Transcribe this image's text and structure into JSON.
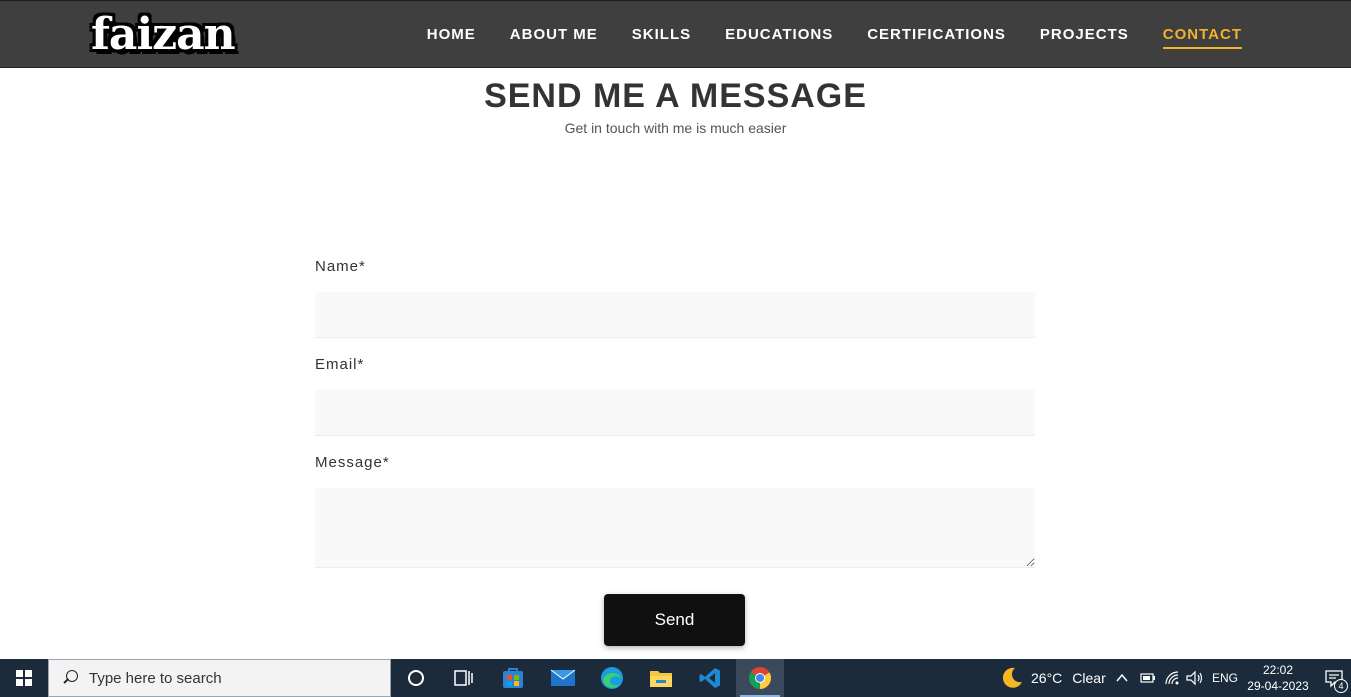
{
  "header": {
    "logo": "faizan",
    "nav": [
      "HOME",
      "ABOUT ME",
      "SKILLS",
      "EDUCATIONS",
      "CERTIFICATIONS",
      "PROJECTS",
      "CONTACT"
    ],
    "active_nav": "CONTACT",
    "accent_color": "#f2b12e"
  },
  "section": {
    "title": "SEND ME A MESSAGE",
    "subtitle": "Get in touch with me is much easier"
  },
  "form": {
    "name_label": "Name*",
    "email_label": "Email*",
    "message_label": "Message*",
    "name_value": "",
    "email_value": "",
    "message_value": "",
    "send_label": "Send"
  },
  "taskbar": {
    "search_placeholder": "Type here to search",
    "apps": [
      "cortana-icon",
      "task-view-icon",
      "store-icon",
      "mail-icon",
      "edge-icon",
      "file-explorer-icon",
      "vscode-icon",
      "chrome-icon"
    ],
    "weather_temp": "26°C",
    "weather_desc": "Clear",
    "language": "ENG",
    "time": "22:02",
    "date": "29-04-2023",
    "notification_count": "4"
  }
}
